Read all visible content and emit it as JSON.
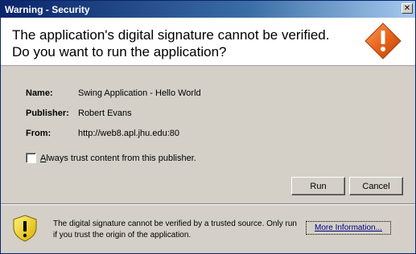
{
  "window": {
    "title": "Warning - Security",
    "close_glyph": "✕"
  },
  "header": {
    "line1": "The application's digital signature cannot be verified.",
    "line2": "Do you want to run the application?",
    "icon": "warning-diamond-icon",
    "icon_color": "#e8641c"
  },
  "details": {
    "name_label": "Name:",
    "name_value": "Swing Application - Hello World",
    "publisher_label": "Publisher:",
    "publisher_value": "Robert Evans",
    "from_label": "From:",
    "from_value": "http://web8.apl.jhu.edu:80"
  },
  "checkbox": {
    "label_mnemonic": "A",
    "label_rest": "lways trust content from this publisher.",
    "checked": false
  },
  "buttons": {
    "run": "Run",
    "cancel": "Cancel"
  },
  "footer": {
    "icon": "shield-warning-icon",
    "message": "The digital signature cannot be verified by a trusted source.  Only run if you trust the origin of the application.",
    "more_info": "More Information..."
  }
}
